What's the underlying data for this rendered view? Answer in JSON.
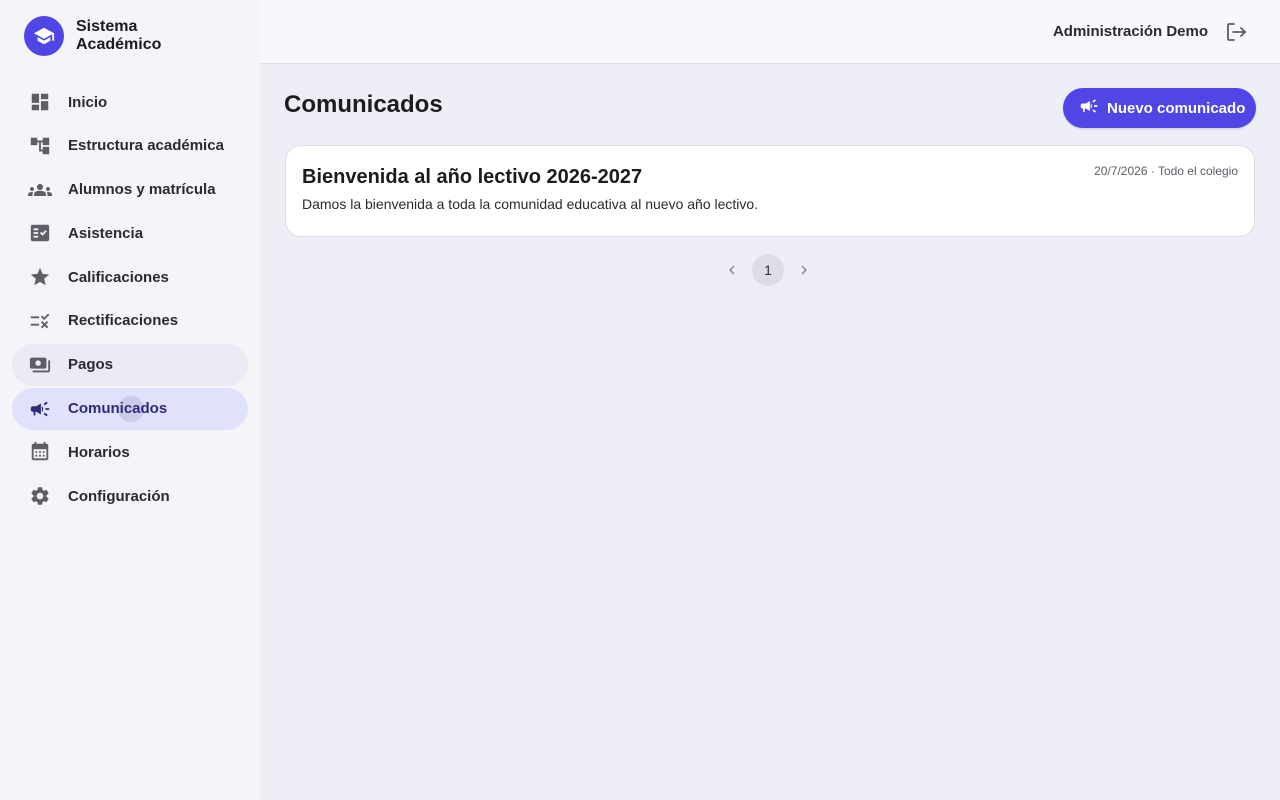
{
  "brand": {
    "line1": "Sistema",
    "line2": "Académico"
  },
  "sidebar": {
    "items": [
      {
        "label": "Inicio",
        "icon": "dashboard-icon"
      },
      {
        "label": "Estructura académica",
        "icon": "account-tree-icon"
      },
      {
        "label": "Alumnos y matrícula",
        "icon": "groups-icon"
      },
      {
        "label": "Asistencia",
        "icon": "fact-check-icon"
      },
      {
        "label": "Calificaciones",
        "icon": "star-icon"
      },
      {
        "label": "Rectificaciones",
        "icon": "rule-icon"
      },
      {
        "label": "Pagos",
        "icon": "payments-icon"
      },
      {
        "label": "Comunicados",
        "icon": "campaign-icon"
      },
      {
        "label": "Horarios",
        "icon": "calendar-icon"
      },
      {
        "label": "Configuración",
        "icon": "gear-icon"
      }
    ],
    "active": "Comunicados",
    "hovered": "Pagos"
  },
  "topbar": {
    "user_name": "Administración Demo",
    "logout_icon": "logout-icon"
  },
  "main": {
    "title": "Comunicados",
    "new_button_label": "Nuevo comunicado",
    "announcements": [
      {
        "title": "Bienvenida al año lectivo 2026-2027",
        "body": "Damos la bienvenida a toda la comunidad educativa al nuevo año lectivo.",
        "meta": "20/7/2026 · Todo el colegio"
      }
    ],
    "pagination": {
      "current_page": "1"
    }
  },
  "colors": {
    "accent": "#4f46e5",
    "sidebar_bg": "#f4f4f9",
    "active_item_bg": "#dfe2fa",
    "content_bg": "#eeeef7"
  }
}
